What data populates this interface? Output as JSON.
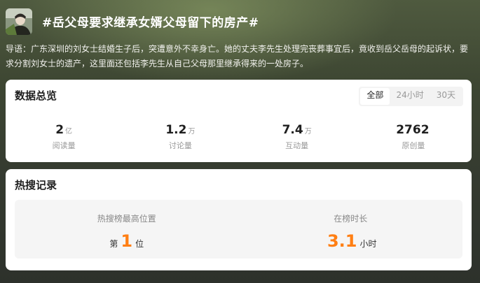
{
  "topic": {
    "title": "#岳父母要求继承女婿父母留下的房产#",
    "intro": "导语：广东深圳的刘女士结婚生子后，突遭意外不幸身亡。她的丈夫李先生处理完丧葬事宜后，竟收到岳父岳母的起诉状，要求分割刘女士的遗产，这里面还包括李先生从自己父母那里继承得来的一处房子。"
  },
  "overview": {
    "title": "数据总览",
    "ranges": [
      "全部",
      "24小时",
      "30天"
    ],
    "active_range": "全部",
    "stats": [
      {
        "value": "2",
        "unit": "亿",
        "label": "阅读量"
      },
      {
        "value": "1.2",
        "unit": "万",
        "label": "讨论量"
      },
      {
        "value": "7.4",
        "unit": "万",
        "label": "互动量"
      },
      {
        "value": "2762",
        "unit": "",
        "label": "原创量"
      }
    ]
  },
  "hot": {
    "title": "热搜记录",
    "highest_label": "热搜榜最高位置",
    "highest_prefix": "第",
    "highest_value": "1",
    "highest_suffix": "位",
    "duration_label": "在榜时长",
    "duration_value": "3.1",
    "duration_unit": "小时"
  },
  "colors": {
    "accent": "#ff7f14",
    "header_bg": "#3d4632"
  }
}
